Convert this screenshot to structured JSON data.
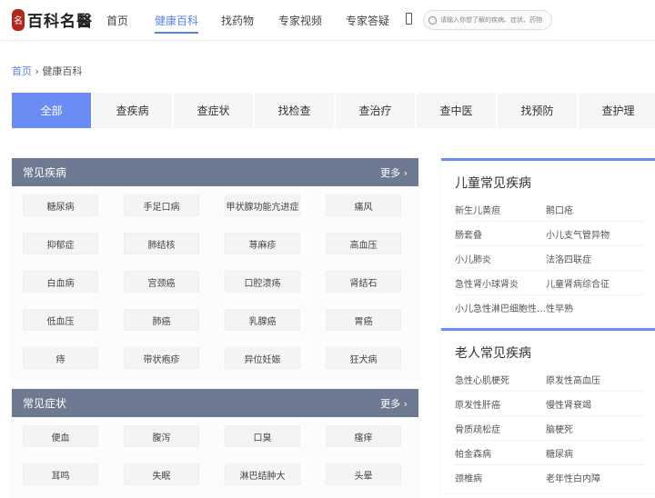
{
  "header": {
    "logo_text": "百科名醫",
    "nav": [
      "首页",
      "健康百科",
      "找药物",
      "专家视频",
      "专家答疑"
    ],
    "active_nav": 1,
    "search_placeholder": "请输入你想了解的疾病、症状、药物"
  },
  "breadcrumb": {
    "home": "首页",
    "sep": "›",
    "current": "健康百科"
  },
  "tabs": [
    "全部",
    "查疾病",
    "查症状",
    "找检查",
    "查治疗",
    "查中医",
    "找预防",
    "查护理"
  ],
  "common_diseases": {
    "title": "常见疾病",
    "more": "更多 ›",
    "items": [
      "糖尿病",
      "手足口病",
      "甲状腺功能亢进症",
      "痛风",
      "抑郁症",
      "肺结核",
      "荨麻疹",
      "高血压",
      "白血病",
      "宫颈癌",
      "口腔溃疡",
      "肾结石",
      "低血压",
      "肺癌",
      "乳腺癌",
      "胃癌",
      "痔",
      "带状疱疹",
      "异位妊娠",
      "狂犬病"
    ]
  },
  "common_symptoms": {
    "title": "常见症状",
    "more": "更多 ›",
    "items": [
      "便血",
      "腹泻",
      "口臭",
      "瘙痒",
      "耳鸣",
      "失眠",
      "淋巴结肿大",
      "头晕"
    ]
  },
  "children": {
    "title": "儿童常见疾病",
    "rows": [
      [
        "新生儿黄疸",
        "鹅口疮"
      ],
      [
        "肠套叠",
        "小儿支气管异物"
      ],
      [
        "小儿肺炎",
        "法洛四联症"
      ],
      [
        "急性肾小球肾炎",
        "儿童肾病综合征"
      ],
      [
        "小儿急性淋巴细胞性白血病",
        "性早熟"
      ]
    ]
  },
  "elderly": {
    "title": "老人常见疾病",
    "rows": [
      [
        "急性心肌梗死",
        "原发性高血压"
      ],
      [
        "原发性肝癌",
        "慢性肾衰竭"
      ],
      [
        "骨质疏松症",
        "脑梗死"
      ],
      [
        "帕金森病",
        "糖尿病"
      ],
      [
        "颈椎病",
        "老年性白内障"
      ]
    ]
  }
}
